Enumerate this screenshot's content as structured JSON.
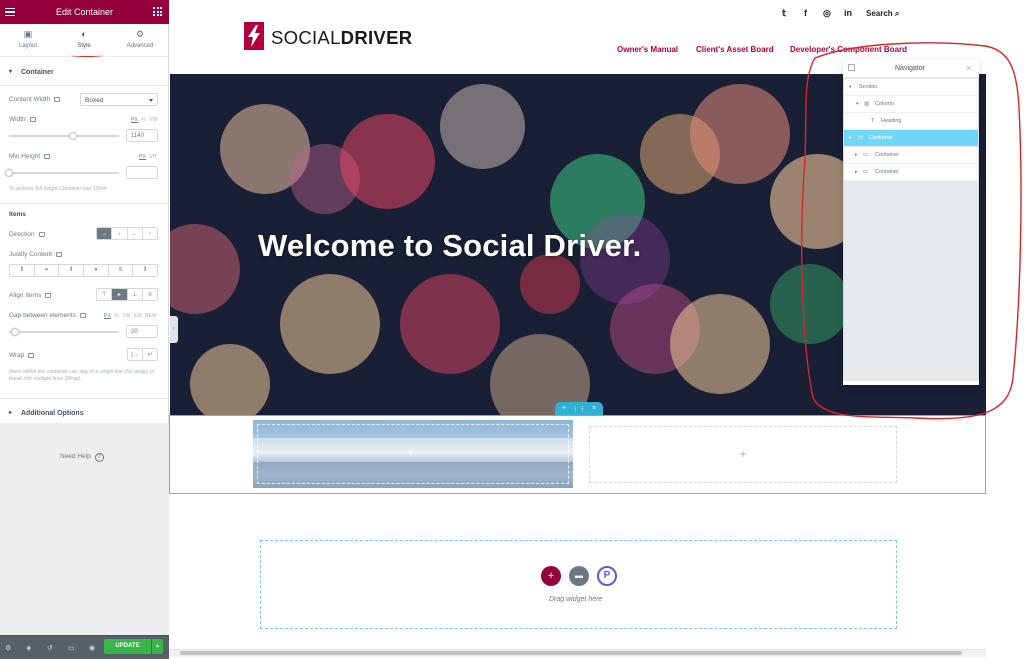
{
  "panel": {
    "title": "Edit Container",
    "tabs": [
      {
        "label": "Layout",
        "icon": "layout-icon"
      },
      {
        "label": "Style",
        "icon": "style-icon"
      },
      {
        "label": "Advanced",
        "icon": "gear-icon"
      }
    ],
    "section_container": "Container",
    "content_width_label": "Content Width",
    "content_width_value": "Boxed",
    "width_label": "Width",
    "width_units": [
      "PX",
      "%",
      "VW"
    ],
    "width_value": "1140",
    "width_fraction": 0.6,
    "min_height_label": "Min Height",
    "min_height_units": [
      "PX",
      "VH"
    ],
    "min_height_note": "To achieve full height Container use 100vh",
    "items_heading": "Items",
    "direction_label": "Direction",
    "direction_options": [
      "→",
      "↓",
      "←",
      "↑"
    ],
    "justify_label": "Justify Content",
    "align_label": "Align Items",
    "gap_label": "Gap between elements",
    "gap_units": [
      "PX",
      "%",
      "VW",
      "EM",
      "REM"
    ],
    "gap_value": "20",
    "gap_fraction": 0.06,
    "wrap_label": "Wrap",
    "wrap_options": [
      "|→",
      "↵"
    ],
    "wrap_note": "Items within the container can stay in a single line (No wrap), or break into multiple lines (Wrap).",
    "additional_options": "Additional Options",
    "need_help": "Need Help",
    "update_label": "UPDATE",
    "update_arrow": "▲"
  },
  "site": {
    "brand_light": "SOCIAL",
    "brand_bold": "DRIVER",
    "search_label": "Search",
    "social_icons": [
      "twitter-icon",
      "facebook-icon",
      "instagram-icon",
      "linkedin-icon"
    ],
    "social_glyphs": [
      "𝕥",
      "f",
      "◎",
      "in"
    ],
    "nav": [
      "Owner's Manual",
      "Client's Asset Board",
      "Developer's Component Board"
    ],
    "hero_title": "Welcome to Social Driver.",
    "drag_widget": "Drag widget here",
    "brand_color": "#b3003c"
  },
  "navigator": {
    "title": "Navigator",
    "close": "×",
    "rows": [
      {
        "label": "Section",
        "level": 0,
        "selected": false
      },
      {
        "label": "Column",
        "level": 1,
        "selected": false
      },
      {
        "label": "Heading",
        "level": 2,
        "selected": false
      },
      {
        "label": "Container",
        "level": 0,
        "selected": true
      },
      {
        "label": "Container",
        "level": 1,
        "selected": false
      },
      {
        "label": "Container",
        "level": 1,
        "selected": false
      }
    ]
  }
}
